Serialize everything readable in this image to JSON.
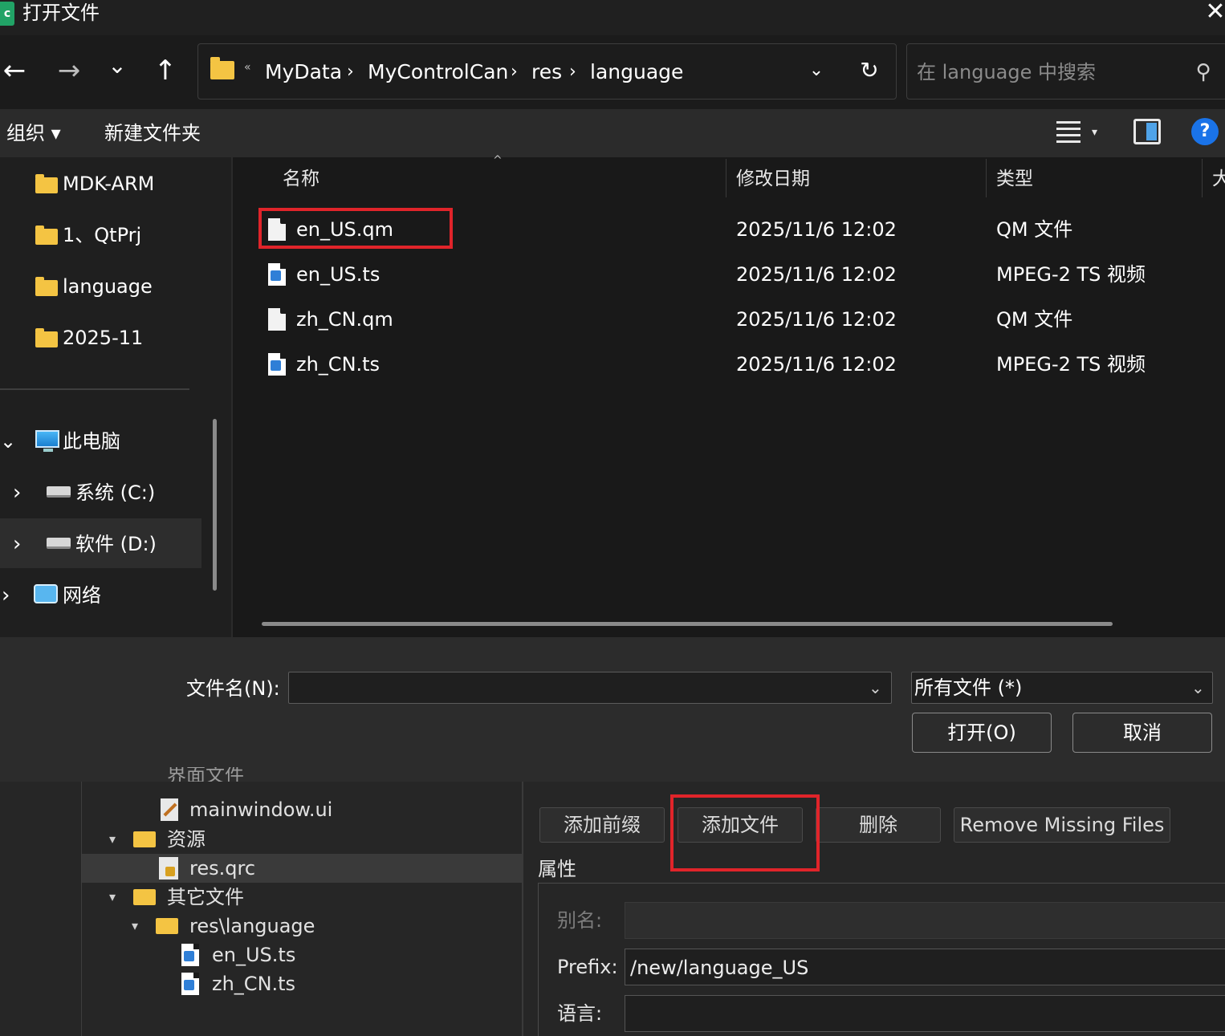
{
  "title_bar": {
    "app_icon_letter": "c",
    "title": "打开文件",
    "close_glyph": "✕"
  },
  "nav": {
    "back_glyph": "←",
    "forward_glyph": "→",
    "recent_glyph": "⌄",
    "up_glyph": "↑",
    "overflow": "«",
    "breadcrumbs": [
      "MyData",
      "MyControlCan",
      "res",
      "language"
    ],
    "separator": "›",
    "dropdown_glyph": "⌄",
    "refresh_glyph": "↻",
    "search_placeholder": "在 language 中搜索",
    "search_glyph": "⚲"
  },
  "commands": {
    "organize": "组织 ▾",
    "new_folder": "新建文件夹",
    "view_caret": "▾",
    "help": "?"
  },
  "sidebar": {
    "quick": [
      {
        "label": "MDK-ARM"
      },
      {
        "label": "1、QtPrj"
      },
      {
        "label": "language"
      },
      {
        "label": "2025-11"
      }
    ],
    "this_pc": {
      "label": "此电脑",
      "chevron": "⌄"
    },
    "drives": [
      {
        "label": "系统 (C:)",
        "chevron": "›"
      },
      {
        "label": "软件 (D:)",
        "chevron": "›",
        "selected": true
      }
    ],
    "network": {
      "label": "网络",
      "chevron": "›"
    }
  },
  "file_list": {
    "columns": [
      "名称",
      "修改日期",
      "类型",
      "大"
    ],
    "sort_indicator": "^",
    "rows": [
      {
        "name": "en_US.qm",
        "date": "2025/11/6 12:02",
        "type": "QM 文件",
        "icon": "blank-file-icon"
      },
      {
        "name": "en_US.ts",
        "date": "2025/11/6 12:02",
        "type": "MPEG-2 TS 视频",
        "icon": "video-file-icon"
      },
      {
        "name": "zh_CN.qm",
        "date": "2025/11/6 12:02",
        "type": "QM 文件",
        "icon": "blank-file-icon"
      },
      {
        "name": "zh_CN.ts",
        "date": "2025/11/6 12:02",
        "type": "MPEG-2 TS 视频",
        "icon": "video-file-icon"
      }
    ],
    "highlight_color": "#e0242a"
  },
  "bottom": {
    "filename_label": "文件名(N):",
    "filename_value": "",
    "dropdown_glyph": "⌄",
    "filetype": "所有文件 (*)",
    "open_button": "打开(O)",
    "cancel_button": "取消"
  },
  "background_app": {
    "tree": {
      "partial_item": "界面文件",
      "items": [
        {
          "label": "mainwindow.ui"
        },
        {
          "label": "资源"
        },
        {
          "label": "res.qrc"
        },
        {
          "label": "其它文件"
        },
        {
          "label": "res\\language"
        },
        {
          "label": "en_US.ts"
        },
        {
          "label": "zh_CN.ts"
        }
      ],
      "expand_glyph": "▾"
    },
    "buttons": {
      "add_prefix": "添加前缀",
      "add_files": "添加文件",
      "remove": "删除",
      "remove_missing": "Remove Missing Files"
    },
    "properties": {
      "title": "属性",
      "alias_label": "别名:",
      "alias_value": "",
      "prefix_label": "Prefix:",
      "prefix_value": "/new/language_US",
      "language_label": "语言:",
      "language_value": ""
    }
  },
  "colors": {
    "accent_blue": "#1a73e8",
    "folder_yellow": "#f4c443",
    "highlight_red": "#e0242a"
  }
}
